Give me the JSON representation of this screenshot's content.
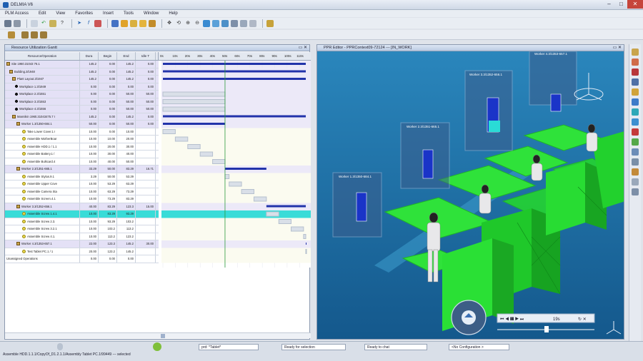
{
  "app": {
    "title": "DELMIA V6"
  },
  "menus": [
    "PLM Access",
    "Edit",
    "View",
    "Favorites",
    "Insert",
    "Tools",
    "Window",
    "Help"
  ],
  "gantt": {
    "title": "Resource Utilization Gantt",
    "columns": [
      "Resource/Operation",
      "Dura",
      "Begin",
      "End",
      "Idle T"
    ],
    "axis_ticks": [
      "0s",
      "10s",
      "20s",
      "30s",
      "40s",
      "50s",
      "60s",
      "70s",
      "80s",
      "90s",
      "100s",
      "110s"
    ],
    "rows": [
      {
        "name": "Site 1960.31043 76.1",
        "d": "145.2",
        "b": "0.00",
        "e": "145.2",
        "i": "0.00"
      },
      {
        "name": "Building.3/1948",
        "d": "145.2",
        "b": "0.00",
        "e": "145.2",
        "i": "0.00"
      },
      {
        "name": "Plant Layout.3/1947",
        "d": "145.2",
        "b": "0.00",
        "e": "145.2",
        "i": "0.00"
      },
      {
        "name": "Workplace 1.3/1949",
        "d": "0.00",
        "b": "0.00",
        "e": "0.00",
        "i": "0.00"
      },
      {
        "name": "Workplace 2.3/1551",
        "d": "0.00",
        "b": "0.00",
        "e": "50.00",
        "i": "50.00"
      },
      {
        "name": "Workplace 3.3/1553",
        "d": "0.00",
        "b": "0.00",
        "e": "50.00",
        "i": "50.00"
      },
      {
        "name": "Workplace 4.3/1556",
        "d": "0.00",
        "b": "0.00",
        "e": "50.00",
        "i": "50.00"
      },
      {
        "name": "Mannikin 1960.31043475.7 I",
        "d": "145.2",
        "b": "0.00",
        "e": "145.2",
        "i": "0.00"
      },
      {
        "name": "Worker 1.3/1350-684.1",
        "d": "50.00",
        "b": "0.00",
        "e": "50.00",
        "i": "0.00"
      },
      {
        "name": "Take Lower Cover.1 I",
        "d": "10.00",
        "b": "0.00",
        "e": "10.00",
        "i": ""
      },
      {
        "name": "Assemble MotherBoar",
        "d": "10.00",
        "b": "10.00",
        "e": "20.00",
        "i": ""
      },
      {
        "name": "Assemble HDD.1 / 1.1",
        "d": "10.00",
        "b": "20.00",
        "e": "30.00",
        "i": ""
      },
      {
        "name": "Assemble Battery.1 /",
        "d": "10.00",
        "b": "30.00",
        "e": "40.00",
        "i": ""
      },
      {
        "name": "Assemble Bulkcard.4",
        "d": "10.00",
        "b": "40.00",
        "e": "50.00",
        "i": ""
      },
      {
        "name": "Worker 2.3/1351-665.1",
        "d": "33.29",
        "b": "50.00",
        "e": "83.29",
        "i": "16.71"
      },
      {
        "name": "Assemble Stylus.9.1",
        "d": "3.29",
        "b": "50.00",
        "e": "53.29",
        "i": ""
      },
      {
        "name": "Assemble Upper Cove",
        "d": "10.00",
        "b": "53.29",
        "e": "63.29",
        "i": ""
      },
      {
        "name": "Assemble Camera Sta",
        "d": "10.00",
        "b": "63.29",
        "e": "73.29",
        "i": ""
      },
      {
        "name": "Assemble Screen.4.1",
        "d": "10.00",
        "b": "73.29",
        "e": "83.29",
        "i": ""
      },
      {
        "name": "Worker 3.3/1352-656.1",
        "d": "40.00",
        "b": "83.29",
        "e": "123.3",
        "i": "15.00"
      },
      {
        "name": "Assemble Screw 1.4.1",
        "d": "10.00",
        "b": "83.29",
        "e": "93.29",
        "i": ""
      },
      {
        "name": "Assemble Screw 2.3.",
        "d": "10.00",
        "b": "93.29",
        "e": "103.2",
        "i": ""
      },
      {
        "name": "Assemble Screw 3.2.1",
        "d": "10.00",
        "b": "103.2",
        "e": "113.2",
        "i": ""
      },
      {
        "name": "Assemble Screw 4.1.",
        "d": "10.00",
        "b": "113.2",
        "e": "123.2",
        "i": ""
      },
      {
        "name": "Worker 4.3/1353-657.1",
        "d": "22.00",
        "b": "123.3",
        "e": "145.2",
        "i": "30.00"
      },
      {
        "name": "Test Tablet PC.1 / 1",
        "d": "20.00",
        "b": "123.2",
        "e": "145.2",
        "i": ""
      },
      {
        "name": "Unassigned Operations",
        "d": "0.00",
        "b": "0.00",
        "e": "0.00",
        "i": ""
      }
    ]
  },
  "viewer": {
    "title": "PPR Editor - PPRContext09-72124 --- [IN_WORK]",
    "workers": [
      "Worker 1.3/1350-684.1",
      "Worker 2.3/1351-665.1",
      "Worker 3.3/1352-656.1",
      "Worker 4.3/1353-657.1"
    ],
    "sim_time": "19s"
  },
  "status": {
    "filter": "prd: *Tablet*",
    "selection": "Ready for selection",
    "chat": "Ready to chat",
    "config": "<No Configuration >",
    "line": "Assemble HDD.1.1.1/CopyOf_D1.2.1.1/Assembly Tablet PC.1/99449 --- selected"
  },
  "colors": {
    "accent": "#2233aa",
    "selected_row": "#39dcd8",
    "green": "#24e02a",
    "viewport": "#1c70a6"
  }
}
